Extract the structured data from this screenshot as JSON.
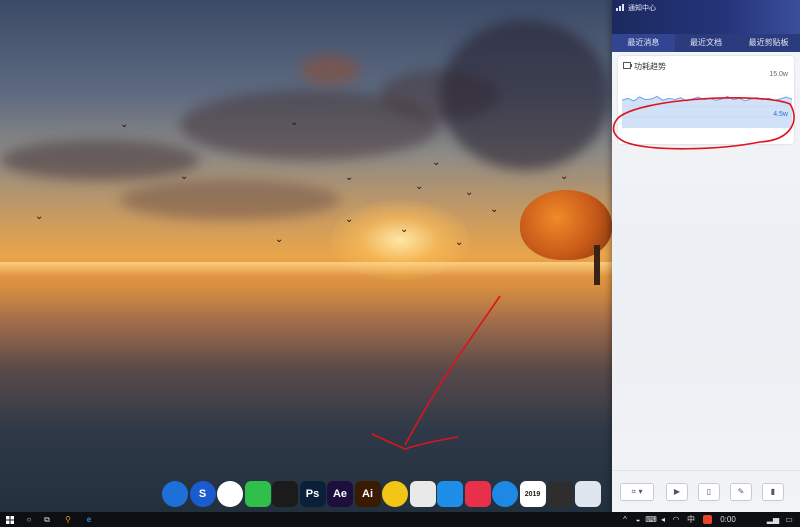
{
  "panel": {
    "title": "通知中心",
    "tabs": [
      {
        "label": "最近消息",
        "active": true
      },
      {
        "label": "最近文档",
        "active": false
      },
      {
        "label": "最近剪贴板",
        "active": false
      }
    ],
    "power_card": {
      "title": "功耗趋势",
      "max_label": "15.0w",
      "current_label": "4.5w"
    },
    "bottom_buttons": [
      "crop-icon",
      "video-icon",
      "document-icon",
      "edit-icon",
      "phone-icon"
    ]
  },
  "chart_data": {
    "type": "area",
    "title": "功耗趋势",
    "y_max_label": "15.0w",
    "current_label": "4.5w",
    "ylim": [
      0,
      15
    ],
    "values": [
      4.3,
      4.6,
      4.2,
      4.8,
      4.4,
      4.5,
      4.9,
      4.3,
      4.6,
      4.4,
      4.7,
      4.2,
      4.5,
      4.8,
      4.4,
      4.6,
      4.3,
      4.5,
      4.9,
      4.4,
      4.6,
      4.2,
      4.5,
      4.7,
      4.4,
      4.6,
      4.3,
      4.5,
      4.8,
      4.5
    ]
  },
  "dock": {
    "apps": [
      {
        "name": "rocket-app-icon",
        "label": "",
        "bg": "#1e6fd8"
      },
      {
        "name": "sogou-browser-icon",
        "label": "S",
        "bg": "#1a5bd0"
      },
      {
        "name": "chrome-icon",
        "label": "",
        "bg": "#ffffff"
      },
      {
        "name": "wechat-icon",
        "label": "",
        "bg": "#2fbf4a"
      },
      {
        "name": "qq-icon",
        "label": "",
        "bg": "#1b1b1b"
      },
      {
        "name": "photoshop-icon",
        "label": "Ps",
        "bg": "#0b1f3a"
      },
      {
        "name": "after-effects-icon",
        "label": "Ae",
        "bg": "#1d0f3d"
      },
      {
        "name": "illustrator-icon",
        "label": "Ai",
        "bg": "#3a1a00"
      },
      {
        "name": "music-app-icon",
        "label": "",
        "bg": "#f2c516"
      },
      {
        "name": "file-manager-icon",
        "label": "",
        "bg": "#e9e9e9"
      },
      {
        "name": "search-app-icon",
        "label": "",
        "bg": "#1f8ee8"
      },
      {
        "name": "image-viewer-icon",
        "label": "",
        "bg": "#e8304a"
      },
      {
        "name": "settings-icon",
        "label": "",
        "bg": "#1e88e5"
      },
      {
        "name": "panda-app-icon",
        "label": "2019",
        "bg": "#ffffff"
      },
      {
        "name": "windows-app-icon",
        "label": "",
        "bg": "#2e2e2e"
      },
      {
        "name": "recycle-bin-icon",
        "label": "",
        "bg": "#dfe6f0"
      }
    ]
  },
  "taskbar": {
    "ime_label": "中",
    "clock": "0:00"
  },
  "colors": {
    "panel_header": "#24347a",
    "accent_blue": "#2f6fd1",
    "annotation_red": "#e0121b"
  }
}
